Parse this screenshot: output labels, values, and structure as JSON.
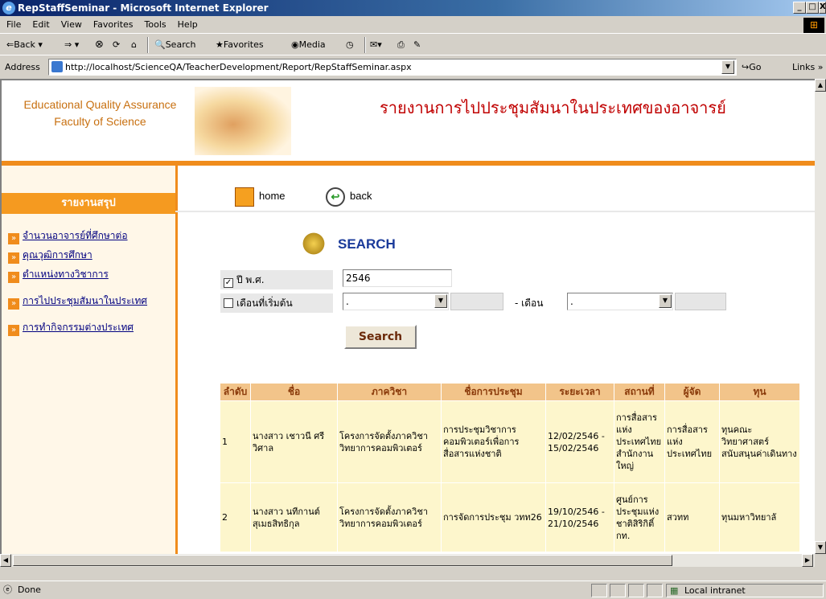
{
  "window": {
    "title": "RepStaffSeminar - Microsoft Internet Explorer",
    "min": "_",
    "max": "□",
    "close": "X"
  },
  "menu": [
    "File",
    "Edit",
    "View",
    "Favorites",
    "Tools",
    "Help"
  ],
  "toolbar": {
    "back": "Back",
    "search": "Search",
    "favorites": "Favorites",
    "media": "Media"
  },
  "address": {
    "label": "Address",
    "url": "http://localhost/ScienceQA/TeacherDevelopment/Report/RepStaffSeminar.aspx",
    "go": "Go",
    "links": "Links"
  },
  "header": {
    "org_line1": "Educational Quality Assurance",
    "org_line2": "Faculty of Science",
    "title": "รายงานการไปประชุมสัมนาในประเทศของอาจารย์"
  },
  "sidebar": {
    "heading": "รายงานสรุป",
    "items": [
      "จำนวนอาจารย์ที่ศึกษาต่อ",
      "คุณวุฒิการศึกษา",
      "ตำแหน่งทางวิชาการ",
      "การไปประชุมสัมนาในประเทศ",
      "การทำกิจกรรมต่างประเทศ"
    ]
  },
  "nav": {
    "home": "home",
    "back": "back"
  },
  "search": {
    "title": "SEARCH",
    "year_label": "ปี พ.ศ.",
    "year_checked": true,
    "year_value": "2546",
    "month_label": "เดือนที่เริ่มต้น",
    "month_checked": false,
    "month_start": ".",
    "month_end_label": "- เดือน",
    "month_end": ".",
    "button": "Search"
  },
  "table": {
    "headers": [
      "ลำดับ",
      "ชื่อ",
      "ภาควิชา",
      "ชื่อการประชุม",
      "ระยะเวลา",
      "สถานที่",
      "ผู้จัด",
      "ทุน"
    ],
    "rows": [
      [
        "1",
        "นางสาว เชาวนี ศรีวิศาล",
        "โครงการจัดตั้งภาควิชาวิทยาการคอมพิวเตอร์",
        "การประชุมวิชาการคอมพิวเตอร์เพื่อการสื่อสารแห่งชาติ",
        "12/02/2546 - 15/02/2546",
        "การสื่อสารแห่งประเทศไทย สำนักงานใหญ่",
        "การสื่อสารแห่งประเทศไทย",
        "ทุนคณะวิทยาศาสตร์ สนับสนุนค่าเดินทาง"
      ],
      [
        "2",
        "นางสาว นทีกานต์ สุเมธสิทธิกุล",
        "โครงการจัดตั้งภาควิชาวิทยาการคอมพิวเตอร์",
        "การจัดการประชุม วทท26",
        "19/10/2546 - 21/10/2546",
        "ศูนย์การประชุมแห่งชาติสิริกิติ์ กท.",
        "สวทท",
        "ทุนมหาวิทยาลั"
      ]
    ]
  },
  "status": {
    "text": "Done",
    "zone": "Local intranet"
  }
}
